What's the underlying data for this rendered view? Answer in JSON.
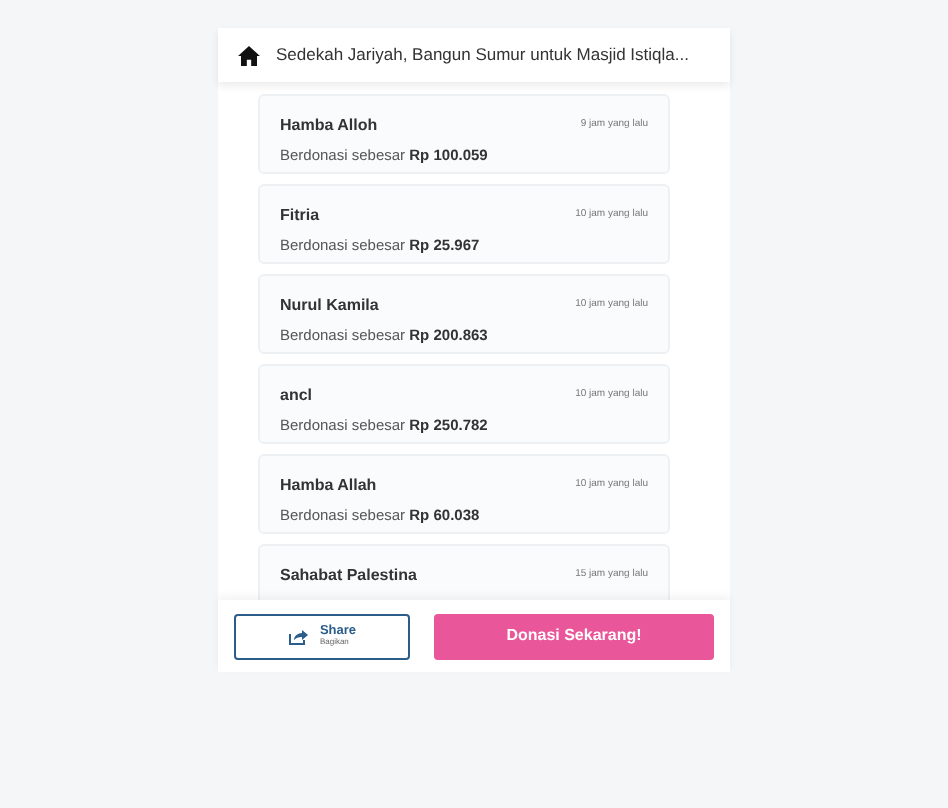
{
  "header": {
    "title": "Sedekah Jariyah, Bangun Sumur untuk Masjid Istiqla..."
  },
  "donations": [
    {
      "name": "Hamba Alloh",
      "time": "9 jam yang lalu",
      "prefix": "Berdonasi sebesar",
      "amount": "Rp 100.059"
    },
    {
      "name": "Fitria",
      "time": "10 jam yang lalu",
      "prefix": "Berdonasi sebesar",
      "amount": "Rp 25.967"
    },
    {
      "name": "Nurul Kamila",
      "time": "10 jam yang lalu",
      "prefix": "Berdonasi sebesar",
      "amount": "Rp 200.863"
    },
    {
      "name": "ancl",
      "time": "10 jam yang lalu",
      "prefix": "Berdonasi sebesar",
      "amount": "Rp 250.782"
    },
    {
      "name": "Hamba Allah",
      "time": "10 jam yang lalu",
      "prefix": "Berdonasi sebesar",
      "amount": "Rp 60.038"
    },
    {
      "name": "Sahabat Palestina",
      "time": "15 jam yang lalu"
    }
  ],
  "share_button": {
    "label": "Share",
    "sublabel": "Bagikan"
  },
  "donate_button": {
    "label": "Donasi Sekarang!"
  }
}
